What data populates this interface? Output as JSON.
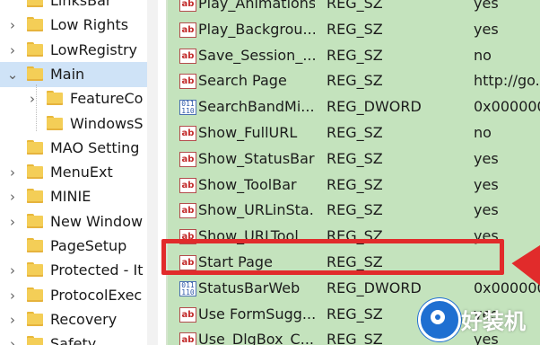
{
  "tree": {
    "items": [
      {
        "label": "LinksBar",
        "expander": false,
        "selected": false
      },
      {
        "label": "Low Rights",
        "expander": true,
        "selected": false
      },
      {
        "label": "LowRegistry",
        "expander": true,
        "selected": false
      },
      {
        "label": "Main",
        "expander": true,
        "expanded": true,
        "selected": true
      },
      {
        "label": "FeatureCo",
        "expander": true,
        "selected": false,
        "child": true
      },
      {
        "label": "WindowsS",
        "expander": false,
        "selected": false,
        "child": true
      },
      {
        "label": "MAO Setting",
        "expander": false,
        "selected": false
      },
      {
        "label": "MenuExt",
        "expander": true,
        "selected": false
      },
      {
        "label": "MINIE",
        "expander": true,
        "selected": false
      },
      {
        "label": "New Window",
        "expander": true,
        "selected": false
      },
      {
        "label": "PageSetup",
        "expander": false,
        "selected": false
      },
      {
        "label": "Protected - It",
        "expander": true,
        "selected": false
      },
      {
        "label": "ProtocolExec",
        "expander": true,
        "selected": false
      },
      {
        "label": "Recovery",
        "expander": true,
        "selected": false
      },
      {
        "label": "Safety",
        "expander": true,
        "selected": false
      }
    ]
  },
  "values": {
    "rows": [
      {
        "icon": "string-value-icon",
        "name": "Play_Animations",
        "type": "REG_SZ",
        "data": "yes"
      },
      {
        "icon": "string-value-icon",
        "name": "Play_Backgrou...",
        "type": "REG_SZ",
        "data": "yes"
      },
      {
        "icon": "string-value-icon",
        "name": "Save_Session_...",
        "type": "REG_SZ",
        "data": "no"
      },
      {
        "icon": "string-value-icon",
        "name": "Search Page",
        "type": "REG_SZ",
        "data": "http://go."
      },
      {
        "icon": "binary-value-icon",
        "name": "SearchBandMi...",
        "type": "REG_DWORD",
        "data": "0x000000"
      },
      {
        "icon": "string-value-icon",
        "name": "Show_FullURL",
        "type": "REG_SZ",
        "data": "no"
      },
      {
        "icon": "string-value-icon",
        "name": "Show_StatusBar",
        "type": "REG_SZ",
        "data": "yes"
      },
      {
        "icon": "string-value-icon",
        "name": "Show_ToolBar",
        "type": "REG_SZ",
        "data": "yes"
      },
      {
        "icon": "string-value-icon",
        "name": "Show_URLinSta...",
        "type": "REG_SZ",
        "data": "yes"
      },
      {
        "icon": "string-value-icon",
        "name": "Show_URLTool...",
        "type": "REG_SZ",
        "data": "yes"
      },
      {
        "icon": "string-value-icon",
        "name": "Start Page",
        "type": "REG_SZ",
        "data": ""
      },
      {
        "icon": "binary-value-icon",
        "name": "StatusBarWeb",
        "type": "REG_DWORD",
        "data": "0x000000"
      },
      {
        "icon": "string-value-icon",
        "name": "Use FormSugg...",
        "type": "REG_SZ",
        "data": "yes"
      },
      {
        "icon": "string-value-icon",
        "name": "Use_DlgBox_C...",
        "type": "REG_SZ",
        "data": "yes"
      }
    ]
  },
  "annotation": {
    "highlight_color": "#e12b2b"
  },
  "watermark": {
    "text": "好装机"
  },
  "colors": {
    "list_bg": "#c4e3bd",
    "selected_bg": "#cfe3f7",
    "folder": "#f4ce57"
  }
}
